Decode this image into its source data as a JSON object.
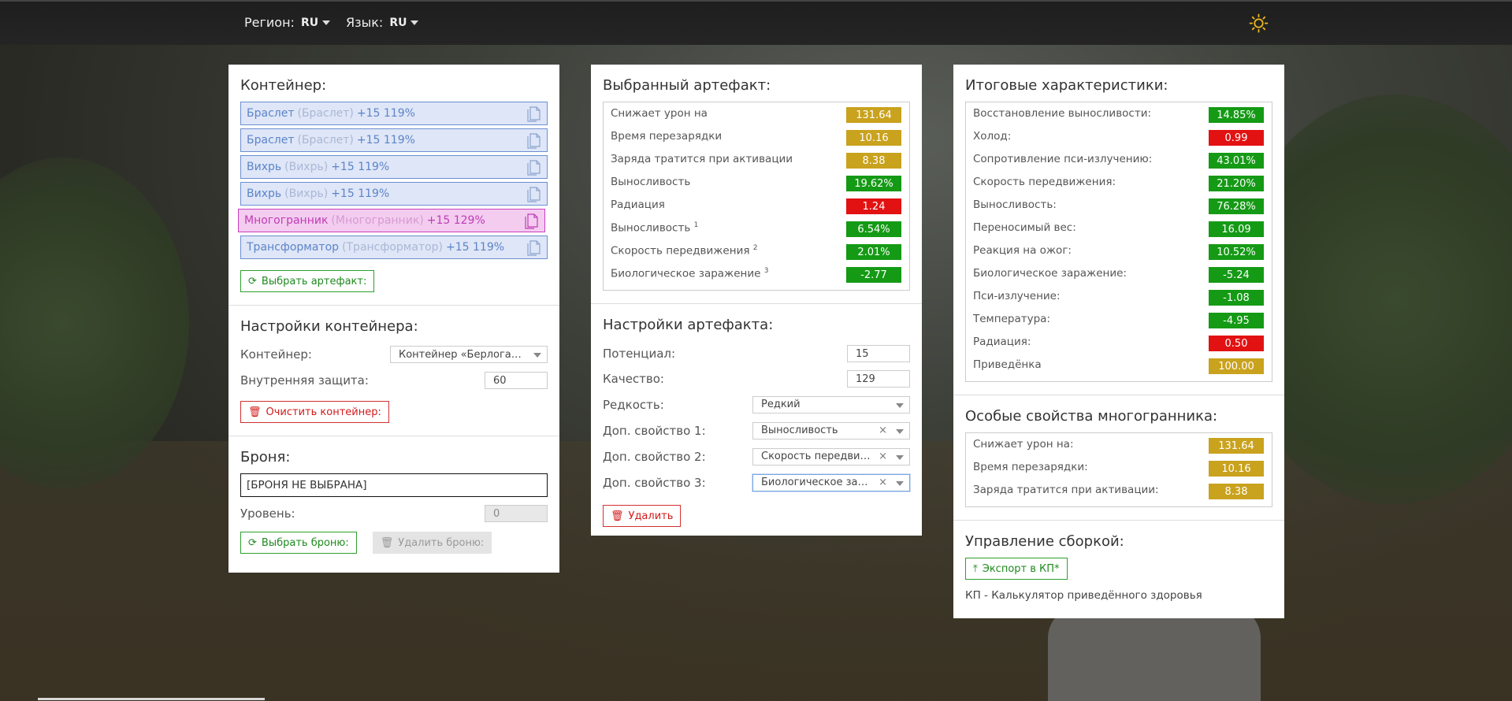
{
  "topbar": {
    "region_label": "Регион:",
    "region_value": "RU",
    "language_label": "Язык:",
    "language_value": "RU"
  },
  "container_panel": {
    "title": "Контейнер:",
    "slots": [
      {
        "name": "Браслет",
        "base": "(Браслет)",
        "level": "+15 119%"
      },
      {
        "name": "Браслет",
        "base": "(Браслет)",
        "level": "+15 119%"
      },
      {
        "name": "Вихрь",
        "base": "(Вихрь)",
        "level": "+15 119%"
      },
      {
        "name": "Вихрь",
        "base": "(Вихрь)",
        "level": "+15 119%"
      },
      {
        "name": "Многогранник",
        "base": "(Многогранник)",
        "level": "+15 129%"
      },
      {
        "name": "Трансформатор",
        "base": "(Трансформатор)",
        "level": "+15 119%"
      }
    ],
    "select_artifact_button": "Выбрать артефакт:",
    "settings_title": "Настройки контейнера:",
    "container_label": "Контейнер:",
    "container_value": "Контейнер «Берлога…",
    "internal_protection_label": "Внутренняя защита:",
    "internal_protection_value": "60",
    "clear_container_button": "Очистить контейнер:",
    "armor_title": "Броня:",
    "armor_value": "[БРОНЯ НЕ ВЫБРАНА]",
    "level_label": "Уровень:",
    "level_value": "0",
    "select_armor_button": "Выбрать броню:",
    "remove_armor_button": "Удалить броню:"
  },
  "artifact_panel": {
    "title": "Выбранный артефакт:",
    "stats": [
      {
        "name": "Снижает урон на",
        "sup": "",
        "value": "131.64",
        "color": "gold"
      },
      {
        "name": "Время перезарядки",
        "sup": "",
        "value": "10.16",
        "color": "gold"
      },
      {
        "name": "Заряда тратится при активации",
        "sup": "",
        "value": "8.38",
        "color": "gold"
      },
      {
        "name": "Выносливость",
        "sup": "",
        "value": "19.62%",
        "color": "green"
      },
      {
        "name": "Радиация",
        "sup": "",
        "value": "1.24",
        "color": "red"
      },
      {
        "name": "Выносливость",
        "sup": "1",
        "value": "6.54%",
        "color": "green"
      },
      {
        "name": "Скорость передвижения",
        "sup": "2",
        "value": "2.01%",
        "color": "green"
      },
      {
        "name": "Биологическое заражение",
        "sup": "3",
        "value": "-2.77",
        "color": "green"
      }
    ],
    "settings_title": "Настройки артефакта:",
    "potential_label": "Потенциал:",
    "potential_value": "15",
    "quality_label": "Качество:",
    "quality_value": "129",
    "rarity_label": "Редкость:",
    "rarity_value": "Редкий",
    "extra1_label": "Доп. свойство 1:",
    "extra1_value": "Выносливость",
    "extra2_label": "Доп. свойство 2:",
    "extra2_value": "Скорость передви…",
    "extra3_label": "Доп. свойство 3:",
    "extra3_value": "Биологическое за…",
    "delete_button": "Удалить"
  },
  "summary_panel": {
    "title": "Итоговые характеристики:",
    "stats": [
      {
        "name": "Восстановление выносливости:",
        "value": "14.85%",
        "color": "green"
      },
      {
        "name": "Холод:",
        "value": "0.99",
        "color": "red"
      },
      {
        "name": "Сопротивление пси-излучению:",
        "value": "43.01%",
        "color": "green"
      },
      {
        "name": "Скорость передвижения:",
        "value": "21.20%",
        "color": "green"
      },
      {
        "name": "Выносливость:",
        "value": "76.28%",
        "color": "green"
      },
      {
        "name": "Переносимый вес:",
        "value": "16.09",
        "color": "green"
      },
      {
        "name": "Реакция на ожог:",
        "value": "10.52%",
        "color": "green"
      },
      {
        "name": "Биологическое заражение:",
        "value": "-5.24",
        "color": "green"
      },
      {
        "name": "Пси-излучение:",
        "value": "-1.08",
        "color": "green"
      },
      {
        "name": "Температура:",
        "value": "-4.95",
        "color": "green"
      },
      {
        "name": "Радиация:",
        "value": "0.50",
        "color": "red"
      },
      {
        "name": "Приведёнка",
        "value": "100.00",
        "color": "gold"
      }
    ],
    "special_title": "Особые свойства многогранника:",
    "special_stats": [
      {
        "name": "Снижает урон на:",
        "value": "131.64",
        "color": "gold"
      },
      {
        "name": "Время перезарядки:",
        "value": "10.16",
        "color": "gold"
      },
      {
        "name": "Заряда тратится при активации:",
        "value": "8.38",
        "color": "gold"
      }
    ],
    "build_title": "Управление сборкой:",
    "export_button": "Экспорт в КП*",
    "footnote": "КП - Калькулятор приведённого здоровья"
  },
  "colors": {
    "gold": "#c9a21e",
    "green": "#159a15",
    "red": "#e21212",
    "slot_blue": "#5b84c9",
    "slot_pink": "#c03cb6"
  }
}
